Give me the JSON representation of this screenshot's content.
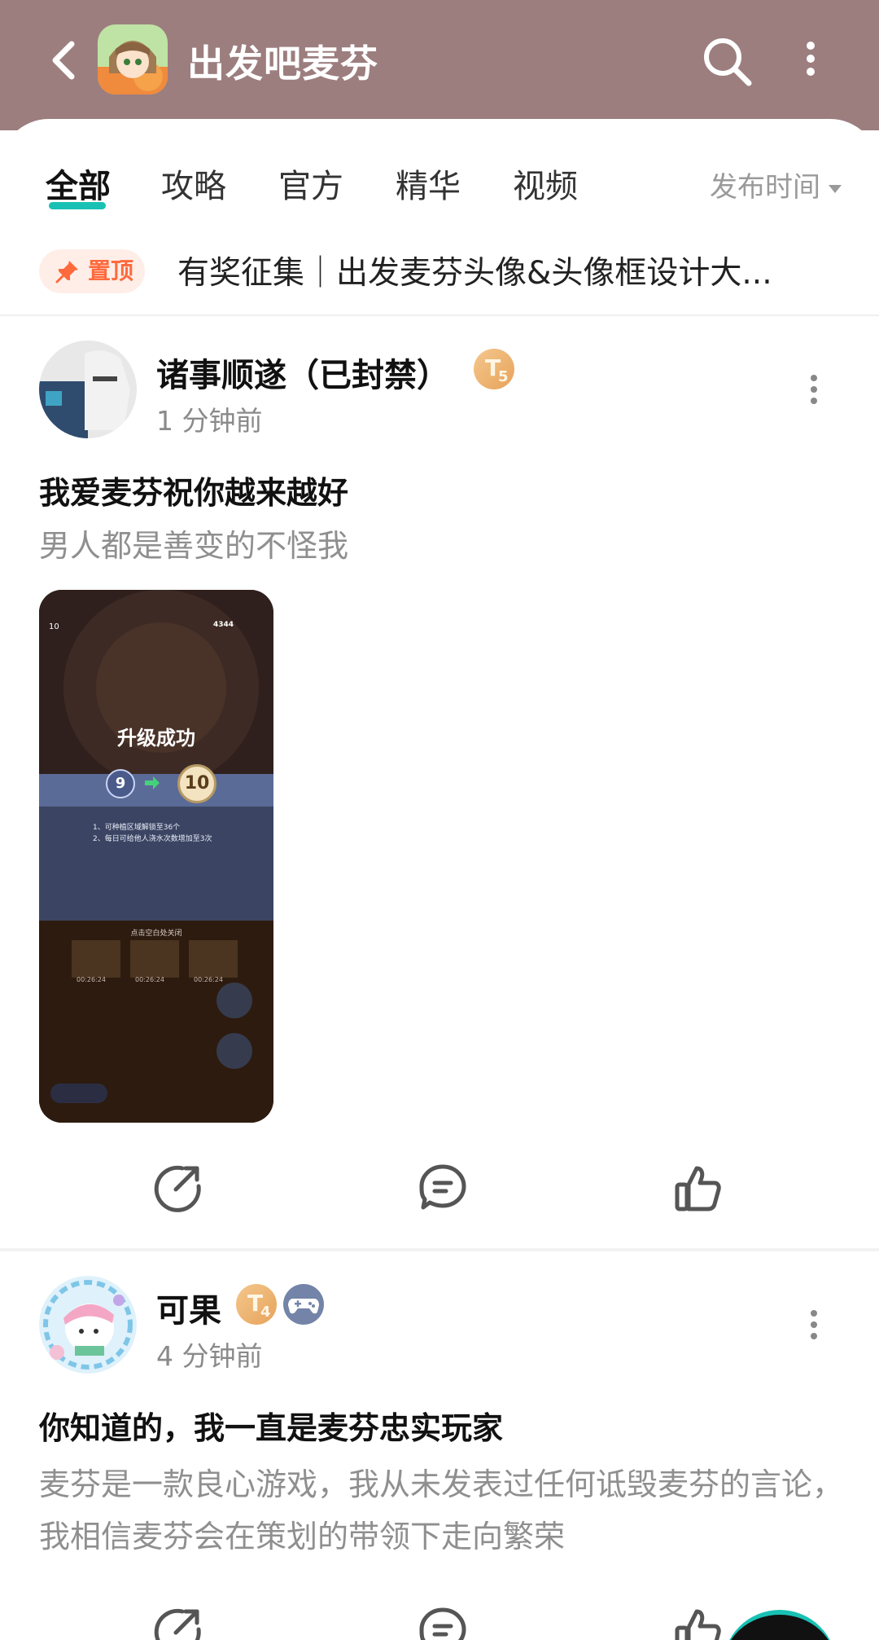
{
  "header": {
    "title": "出发吧麦芬"
  },
  "tabs": [
    {
      "label": "全部",
      "active": true
    },
    {
      "label": "攻略",
      "active": false
    },
    {
      "label": "官方",
      "active": false
    },
    {
      "label": "精华",
      "active": false
    },
    {
      "label": "视频",
      "active": false
    }
  ],
  "sort": {
    "label": "发布时间"
  },
  "pinned": {
    "badge": "置顶",
    "text": "有奖征集｜出发麦芬头像&头像框设计大..."
  },
  "posts": [
    {
      "username": "诸事顺遂（已封禁）",
      "level": {
        "letter": "T",
        "number": "5"
      },
      "time": "1 分钟前",
      "title": "我爱麦芬祝你越来越好",
      "body": "男人都是善变的不怪我",
      "image": {
        "level_up_title": "升级成功",
        "from_level": "9",
        "to_level": "10",
        "line1": "1、可种植区域解锁至36个",
        "line2": "2、每日可给他人浇水次数增加至3次",
        "close_hint": "点击空白处关闭",
        "coins": "4344",
        "corner_level": "10",
        "timers": [
          "00:26:24",
          "00:26:24",
          "00:26:24"
        ]
      }
    },
    {
      "username": "可果",
      "level": {
        "letter": "T",
        "number": "4"
      },
      "time": "4 分钟前",
      "title": "你知道的，我一直是麦芬忠实玩家",
      "body": "麦芬是一款良心游戏，我从未发表过任何诋毁麦芬的言论，我相信麦芬会在策划的带领下走向繁荣"
    }
  ],
  "colors": {
    "header_bg": "#9c7e7f",
    "accent": "#19c1b4",
    "pin_text": "#ff6a3d",
    "muted_text": "#8f8f8f"
  },
  "icons": [
    "back-arrow-icon",
    "search-icon",
    "more-vertical-icon",
    "pin-icon",
    "share-icon",
    "comment-icon",
    "like-icon",
    "gamepad-icon"
  ]
}
